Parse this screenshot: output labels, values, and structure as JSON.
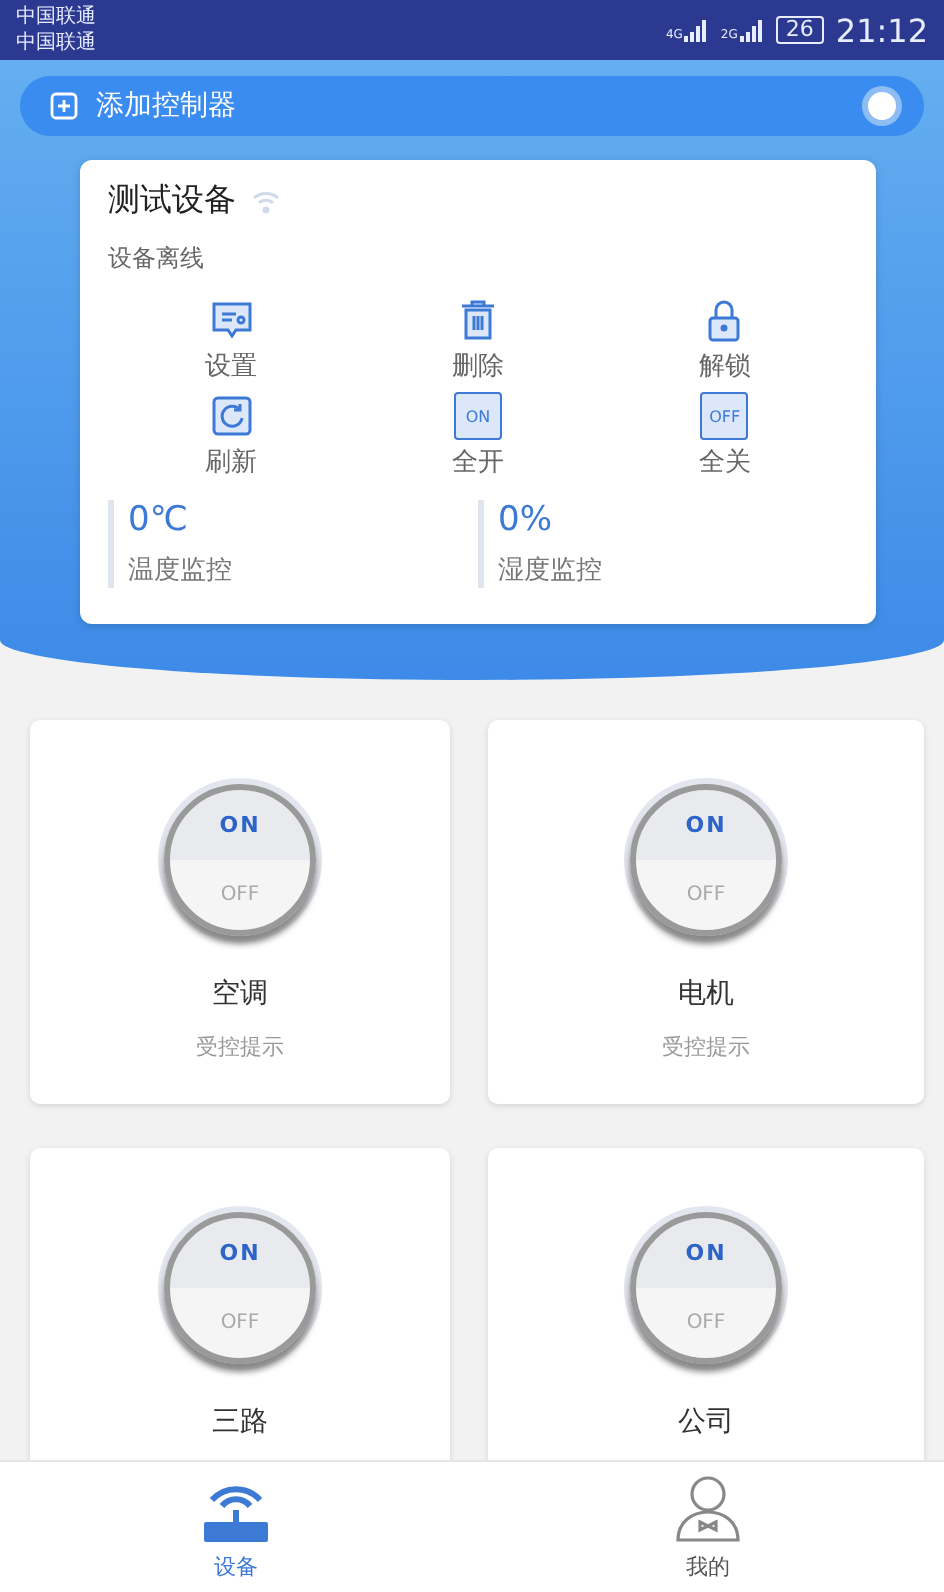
{
  "status_bar": {
    "carriers": [
      "中国联通",
      "中国联通"
    ],
    "networks": [
      "4G",
      "2G"
    ],
    "battery": "26",
    "time": "21:12"
  },
  "add_bar": {
    "label": "添加控制器"
  },
  "device": {
    "name": "测试设备",
    "status": "设备离线",
    "actions": [
      {
        "label": "设置",
        "kind": "settings"
      },
      {
        "label": "删除",
        "kind": "trash"
      },
      {
        "label": "解锁",
        "kind": "lock"
      },
      {
        "label": "刷新",
        "kind": "refresh"
      },
      {
        "label": "全开",
        "kind": "on",
        "icon_text": "ON"
      },
      {
        "label": "全关",
        "kind": "off",
        "icon_text": "OFF"
      }
    ],
    "monitors": [
      {
        "value": "0℃",
        "label": "温度监控"
      },
      {
        "value": "0%",
        "label": "湿度监控"
      }
    ]
  },
  "controls": [
    {
      "name": "空调",
      "hint": "受控提示",
      "on": true,
      "on_label": "ON",
      "off_label": "OFF"
    },
    {
      "name": "电机",
      "hint": "受控提示",
      "on": true,
      "on_label": "ON",
      "off_label": "OFF"
    },
    {
      "name": "三路",
      "on": true,
      "on_label": "ON",
      "off_label": "OFF"
    },
    {
      "name": "公司",
      "on": true,
      "on_label": "ON",
      "off_label": "OFF"
    }
  ],
  "tabs": [
    {
      "label": "设备",
      "kind": "router",
      "selected": true
    },
    {
      "label": "我的",
      "kind": "person",
      "selected": false
    }
  ]
}
